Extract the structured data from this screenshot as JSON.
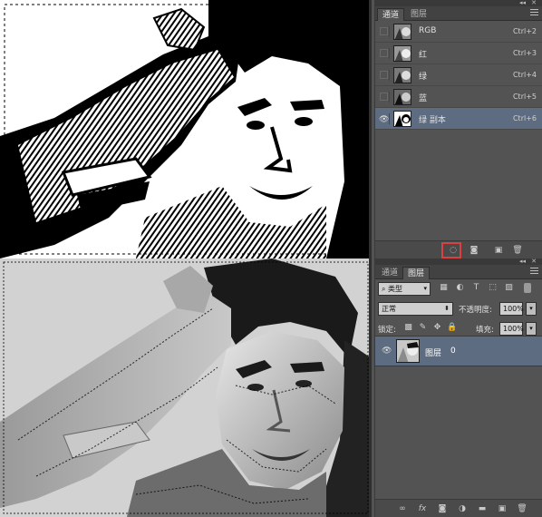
{
  "top": {
    "panel": {
      "tabs": [
        {
          "label": "通道",
          "active": true
        },
        {
          "label": "图层",
          "active": false
        }
      ],
      "collapse_icon": "double-arrow-icon",
      "close_icon": "close-icon",
      "channels": [
        {
          "name": "RGB",
          "shortcut": "Ctrl+2",
          "visible": false,
          "selected": false
        },
        {
          "name": "红",
          "shortcut": "Ctrl+3",
          "visible": false,
          "selected": false
        },
        {
          "name": "绿",
          "shortcut": "Ctrl+4",
          "visible": false,
          "selected": false
        },
        {
          "name": "蓝",
          "shortcut": "Ctrl+5",
          "visible": false,
          "selected": false
        },
        {
          "name": "绿 副本",
          "shortcut": "Ctrl+6",
          "visible": true,
          "selected": true
        }
      ],
      "footer_icons": [
        "load-channel-as-selection-icon",
        "save-selection-as-channel-icon",
        "new-channel-icon",
        "delete-channel-icon"
      ]
    }
  },
  "bottom": {
    "panel": {
      "tabs": [
        {
          "label": "通道",
          "active": false
        },
        {
          "label": "图层",
          "active": true
        }
      ],
      "filter_label": "类型",
      "blend_mode": "正常",
      "opacity_label": "不透明度:",
      "opacity_value": "100%",
      "lock_label": "锁定:",
      "fill_label": "填充:",
      "fill_value": "100%",
      "layer": {
        "name": "图层",
        "index": "0"
      },
      "footer_icons": [
        "link-layers-icon",
        "fx-icon",
        "add-mask-icon",
        "adjustment-layer-icon",
        "new-group-icon",
        "new-layer-icon",
        "delete-layer-icon"
      ],
      "fx_text": "fx"
    }
  },
  "colors": {
    "panel_bg": "#535353",
    "selected_row": "#5d6c81",
    "highlight_box": "#d94040"
  }
}
